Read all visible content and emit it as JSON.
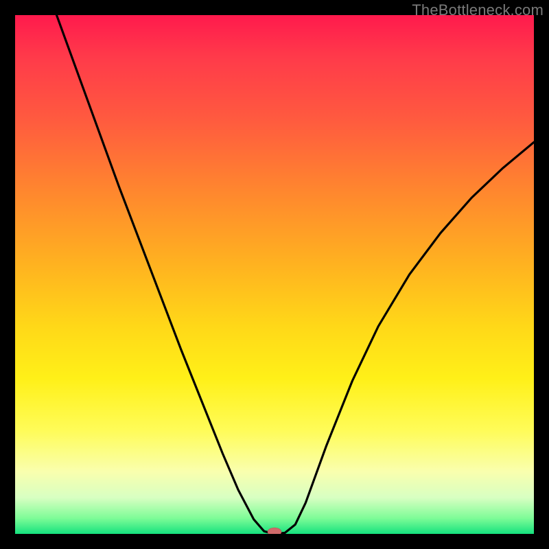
{
  "watermark": "TheBottleneck.com",
  "chart_data": {
    "type": "line",
    "title": "",
    "xlabel": "",
    "ylabel": "",
    "xlim": [
      0,
      1
    ],
    "ylim": [
      0,
      1
    ],
    "series": [
      {
        "name": "bottleneck-curve",
        "x": [
          0.08,
          0.12,
          0.16,
          0.2,
          0.24,
          0.28,
          0.32,
          0.36,
          0.4,
          0.43,
          0.46,
          0.48,
          0.5,
          0.52,
          0.54,
          0.56,
          0.6,
          0.65,
          0.7,
          0.76,
          0.82,
          0.88,
          0.94,
          1.0
        ],
        "values": [
          1.0,
          0.89,
          0.78,
          0.67,
          0.565,
          0.46,
          0.355,
          0.255,
          0.155,
          0.085,
          0.028,
          0.005,
          0.0,
          0.002,
          0.018,
          0.06,
          0.17,
          0.295,
          0.4,
          0.5,
          0.58,
          0.648,
          0.705,
          0.755
        ]
      }
    ],
    "marker": {
      "x": 0.5,
      "y": 0.0
    },
    "gradient_stops": [
      {
        "pos": 0.0,
        "color": "#ff1a4d"
      },
      {
        "pos": 0.2,
        "color": "#ff5a3f"
      },
      {
        "pos": 0.48,
        "color": "#ffb220"
      },
      {
        "pos": 0.7,
        "color": "#fff018"
      },
      {
        "pos": 0.93,
        "color": "#d8ffc2"
      },
      {
        "pos": 1.0,
        "color": "#15e27e"
      }
    ]
  }
}
